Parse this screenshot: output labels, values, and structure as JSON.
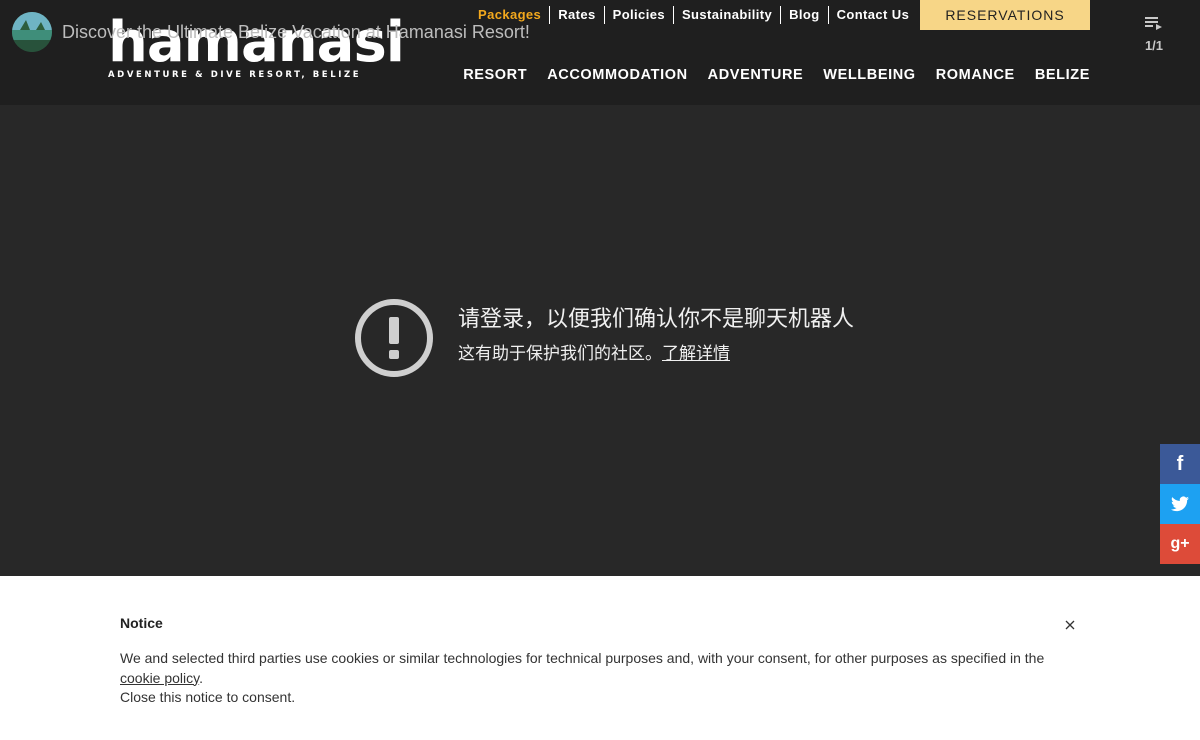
{
  "video": {
    "title": "Discover the Ultimate Belize Vacation at Hamanasi Resort!",
    "playlist_count": "1/1"
  },
  "brand": {
    "name": "hamanasi",
    "tagline": "ADVENTURE & DIVE RESORT, BELIZE"
  },
  "top_nav": [
    {
      "label": "Packages",
      "active": true
    },
    {
      "label": "Rates"
    },
    {
      "label": "Policies"
    },
    {
      "label": "Sustainability"
    },
    {
      "label": "Blog"
    },
    {
      "label": "Contact Us"
    }
  ],
  "reservations_label": "RESERVATIONS",
  "main_nav": [
    "RESORT",
    "ACCOMMODATION",
    "ADVENTURE",
    "WELLBEING",
    "ROMANCE",
    "BELIZE"
  ],
  "error": {
    "title": "请登录，以便我们确认你不是聊天机器人",
    "subtitle": "这有助于保护我们的社区。",
    "link": "了解详情"
  },
  "social": {
    "facebook": "f",
    "twitter": "twitter-icon",
    "google_plus": "g+"
  },
  "notice": {
    "title": "Notice",
    "body_before": "We and selected third parties use cookies or similar technologies for technical purposes and, with your consent, for other purposes as specified in the ",
    "link": "cookie policy",
    "body_after": ".",
    "line2": "Close this notice to consent."
  },
  "colors": {
    "header_bg": "#1f1f1f",
    "page_bg": "#282828",
    "active_link": "#f2a81d",
    "reservations_bg": "#f7d687",
    "facebook": "#3b5998",
    "twitter": "#1da1f2",
    "google_plus": "#dd4b39"
  }
}
